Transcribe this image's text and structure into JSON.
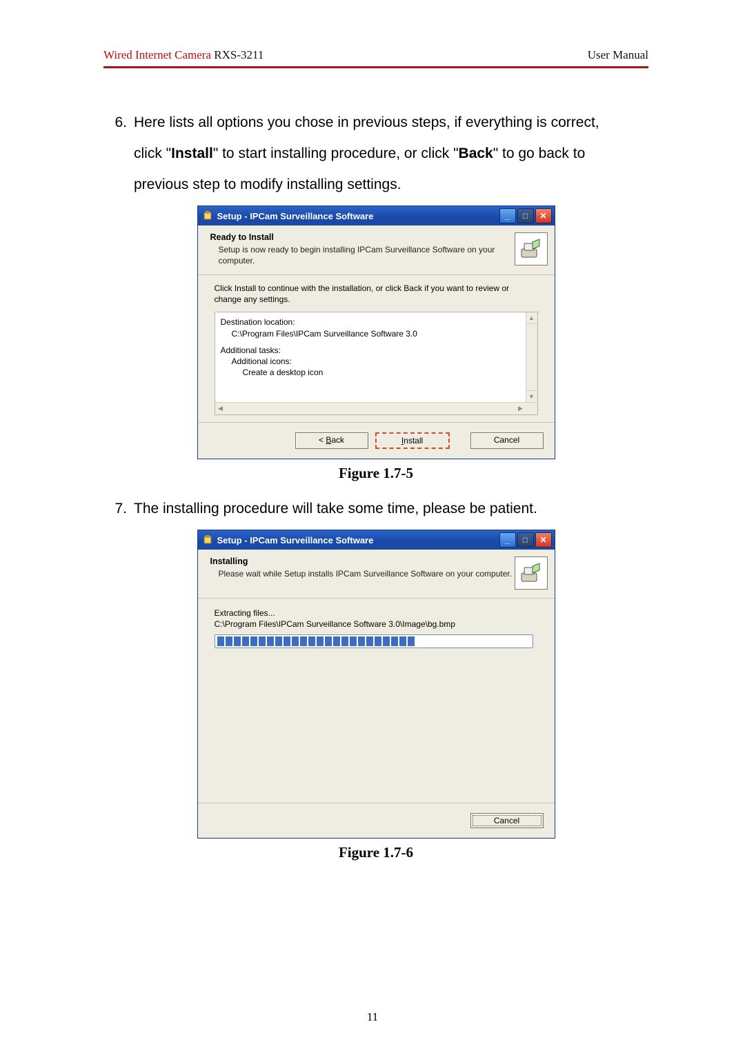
{
  "header": {
    "product": "Wired Internet Camera",
    "model": " RXS-3211",
    "right": "User Manual"
  },
  "step6_num": "6.",
  "step6_line1": "Here lists all options you chose in previous steps, if everything is correct,",
  "step6_line2_pre": "click \"",
  "step6_install": "Install",
  "step6_line2_mid": "\" to start installing procedure, or click \"",
  "step6_back": "Back",
  "step6_line2_post": "\" to go back to",
  "step6_line3": "previous step to modify installing settings.",
  "step7_num": "7.",
  "step7_text": "The installing procedure will take some time, please be patient.",
  "figcap1": "Figure 1.7-5",
  "figcap2": "Figure 1.7-6",
  "page_number": "11",
  "win1": {
    "title": "Setup - IPCam Surveillance Software",
    "heading": "Ready to Install",
    "subtext": "Setup is now ready to begin installing IPCam Surveillance Software on your computer.",
    "instruction": "Click Install to continue with the installation, or click Back if you want to review or change any settings.",
    "dest_label": "Destination location:",
    "dest_path": "C:\\Program Files\\IPCam Surveillance Software 3.0",
    "tasks_label": "Additional tasks:",
    "icons_label": "Additional icons:",
    "desktop_label": "Create a desktop icon",
    "btn_back_prefix": "< ",
    "btn_back_u": "B",
    "btn_back_rest": "ack",
    "btn_install_u": "I",
    "btn_install_rest": "nstall",
    "btn_cancel": "Cancel"
  },
  "win2": {
    "title": "Setup - IPCam Surveillance Software",
    "heading": "Installing",
    "subtext": "Please wait while Setup installs IPCam Surveillance Software on your computer.",
    "extracting": "Extracting files...",
    "extract_path": "C:\\Program Files\\IPCam Surveillance Software 3.0\\Image\\bg.bmp",
    "btn_cancel": "Cancel"
  }
}
